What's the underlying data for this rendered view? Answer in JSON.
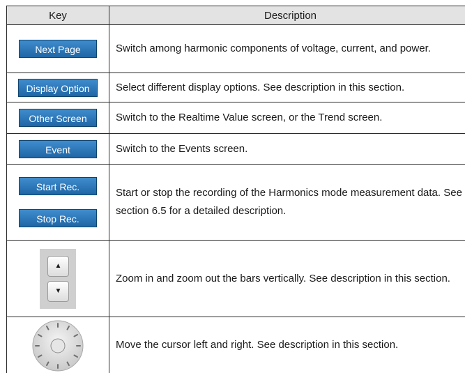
{
  "table": {
    "header": {
      "key": "Key",
      "description": "Description"
    },
    "rows": [
      {
        "keys": [
          "Next Page"
        ],
        "description": "Switch among harmonic components of voltage, current, and power."
      },
      {
        "keys": [
          "Display Option"
        ],
        "description": "Select different display options. See description in this section."
      },
      {
        "keys": [
          "Other Screen"
        ],
        "description": "Switch to the Realtime Value screen, or the Trend screen."
      },
      {
        "keys": [
          "Event"
        ],
        "description": "Switch to the Events screen."
      },
      {
        "keys": [
          "Start Rec.",
          "Stop Rec."
        ],
        "description": "Start or stop the recording of the Harmonics mode measurement data. See section 6.5 for a detailed description."
      },
      {
        "keys": [
          "zoom-up-icon",
          "zoom-down-icon"
        ],
        "description": "Zoom in and zoom out the bars vertically. See description in this section."
      },
      {
        "keys": [
          "rotary-knob-icon"
        ],
        "description": "Move the cursor left and right. See description in this section."
      }
    ]
  },
  "icons": {
    "zoom_up": "▲",
    "zoom_down": "▼"
  },
  "colors": {
    "button_fill": "#2a74b8",
    "button_text": "#ffffff",
    "header_fill": "#e3e3e3"
  }
}
